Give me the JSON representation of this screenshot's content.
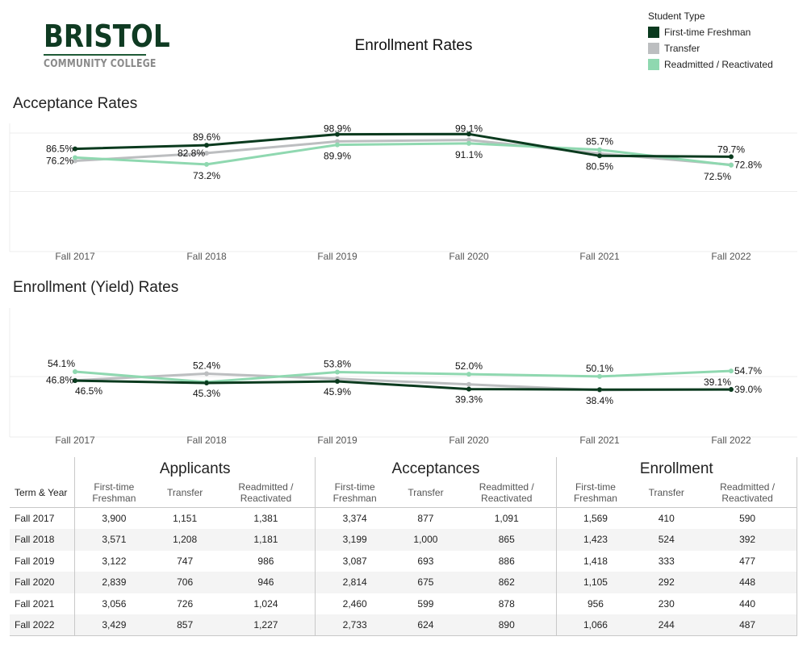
{
  "header": {
    "logo_main": "BRISTOL",
    "logo_sub": "COMMUNITY COLLEGE",
    "title": "Enrollment Rates"
  },
  "legend": {
    "title": "Student Type",
    "items": [
      {
        "label": "First-time Freshman",
        "color": "#0a3a1e"
      },
      {
        "label": "Transfer",
        "color": "#bcbec0"
      },
      {
        "label": "Readmitted / Reactivated",
        "color": "#8fd8b0"
      }
    ]
  },
  "chart_data": [
    {
      "type": "line",
      "title": "Acceptance Rates",
      "categories": [
        "Fall 2017",
        "Fall 2018",
        "Fall 2019",
        "Fall 2020",
        "Fall 2021",
        "Fall 2022"
      ],
      "ylim": [
        0,
        100
      ],
      "gridlines": [
        50,
        100
      ],
      "grid": true,
      "series": [
        {
          "name": "Transfer",
          "values": [
            76.2,
            82.8,
            92.8,
            94.1,
            82.5,
            72.8
          ],
          "labels": [
            "76.2%",
            "82.8%",
            null,
            null,
            null,
            "72.8%"
          ]
        },
        {
          "name": "Readmitted / Reactivated",
          "values": [
            79.0,
            73.2,
            89.9,
            91.1,
            85.7,
            72.5
          ],
          "labels": [
            null,
            "73.2%",
            "89.9%",
            "91.1%",
            "85.7%",
            "72.5%"
          ]
        },
        {
          "name": "First-time Freshman",
          "values": [
            86.5,
            89.6,
            98.9,
            99.1,
            80.5,
            79.7
          ],
          "labels": [
            "86.5%",
            "89.6%",
            "98.9%",
            "99.1%",
            "80.5%",
            "79.7%"
          ]
        }
      ]
    },
    {
      "type": "line",
      "title": "Enrollment (Yield) Rates",
      "categories": [
        "Fall 2017",
        "Fall 2018",
        "Fall 2019",
        "Fall 2020",
        "Fall 2021",
        "Fall 2022"
      ],
      "ylim": [
        0,
        100
      ],
      "gridlines": [
        50
      ],
      "grid": true,
      "series": [
        {
          "name": "Transfer",
          "values": [
            46.8,
            52.4,
            48.1,
            43.3,
            38.4,
            39.1
          ],
          "labels": [
            "46.8%",
            "52.4%",
            null,
            null,
            "38.4%",
            "39.1%"
          ]
        },
        {
          "name": "Readmitted / Reactivated",
          "values": [
            54.1,
            45.3,
            53.8,
            52.0,
            50.1,
            54.7
          ],
          "labels": [
            "54.1%",
            "45.3%",
            "53.8%",
            "52.0%",
            "50.1%",
            "54.7%"
          ]
        },
        {
          "name": "First-time Freshman",
          "values": [
            46.5,
            44.5,
            45.9,
            39.3,
            38.9,
            39.0
          ],
          "labels": [
            "46.5%",
            null,
            "45.9%",
            "39.3%",
            null,
            "39.0%"
          ]
        }
      ]
    }
  ],
  "table": {
    "term_header": "Term & Year",
    "groups": [
      "Applicants",
      "Acceptances",
      "Enrollment"
    ],
    "sub_headers": [
      "First-time Freshman",
      "Transfer",
      "Readmitted / Reactivated"
    ],
    "sub_headers_lines": [
      [
        "First-time",
        "Freshman"
      ],
      [
        "Transfer"
      ],
      [
        "Readmitted /",
        "Reactivated"
      ]
    ],
    "rows": [
      {
        "term": "Fall 2017",
        "values": [
          "3,900",
          "1,151",
          "1,381",
          "3,374",
          "877",
          "1,091",
          "1,569",
          "410",
          "590"
        ]
      },
      {
        "term": "Fall 2018",
        "values": [
          "3,571",
          "1,208",
          "1,181",
          "3,199",
          "1,000",
          "865",
          "1,423",
          "524",
          "392"
        ]
      },
      {
        "term": "Fall 2019",
        "values": [
          "3,122",
          "747",
          "986",
          "3,087",
          "693",
          "886",
          "1,418",
          "333",
          "477"
        ]
      },
      {
        "term": "Fall 2020",
        "values": [
          "2,839",
          "706",
          "946",
          "2,814",
          "675",
          "862",
          "1,105",
          "292",
          "448"
        ]
      },
      {
        "term": "Fall 2021",
        "values": [
          "3,056",
          "726",
          "1,024",
          "2,460",
          "599",
          "878",
          "956",
          "230",
          "440"
        ]
      },
      {
        "term": "Fall 2022",
        "values": [
          "3,429",
          "857",
          "1,227",
          "2,733",
          "624",
          "890",
          "1,066",
          "244",
          "487"
        ]
      }
    ]
  }
}
